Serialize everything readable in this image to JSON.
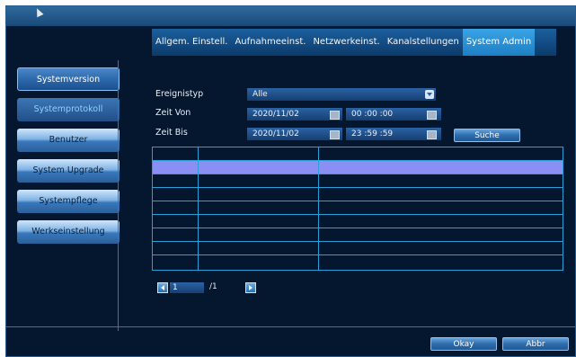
{
  "tabs": [
    {
      "label": "Allgem. Einstell."
    },
    {
      "label": "Aufnahmeeinst."
    },
    {
      "label": "Netzwerkeinst."
    },
    {
      "label": "Kanalstellungen"
    },
    {
      "label": "System Admin"
    }
  ],
  "sidebar": {
    "items": [
      {
        "label": "Systemversion"
      },
      {
        "label": "Systemprotokoll"
      },
      {
        "label": "Benutzer"
      },
      {
        "label": "System Upgrade"
      },
      {
        "label": "Systempflege"
      },
      {
        "label": "Werkseinstellung"
      }
    ]
  },
  "form": {
    "event_type_label": "Ereignistyp",
    "event_type_value": "Alle",
    "time_from_label": "Zeit Von",
    "time_from_date": "2020/11/02",
    "time_from_time": "00 :00 :00",
    "time_to_label": "Zeit Bis",
    "time_to_date": "2020/11/02",
    "time_to_time": "23 :59 :59",
    "search_label": "Suche"
  },
  "pager": {
    "current": "1",
    "total": "/1"
  },
  "footer": {
    "ok_label": "Okay",
    "cancel_label": "Abbr"
  },
  "colors": {
    "background": "#04172e",
    "accent_tab": "#2a90d6",
    "row_highlight": "#8b8ef2",
    "table_border": "#2aa0d8"
  }
}
